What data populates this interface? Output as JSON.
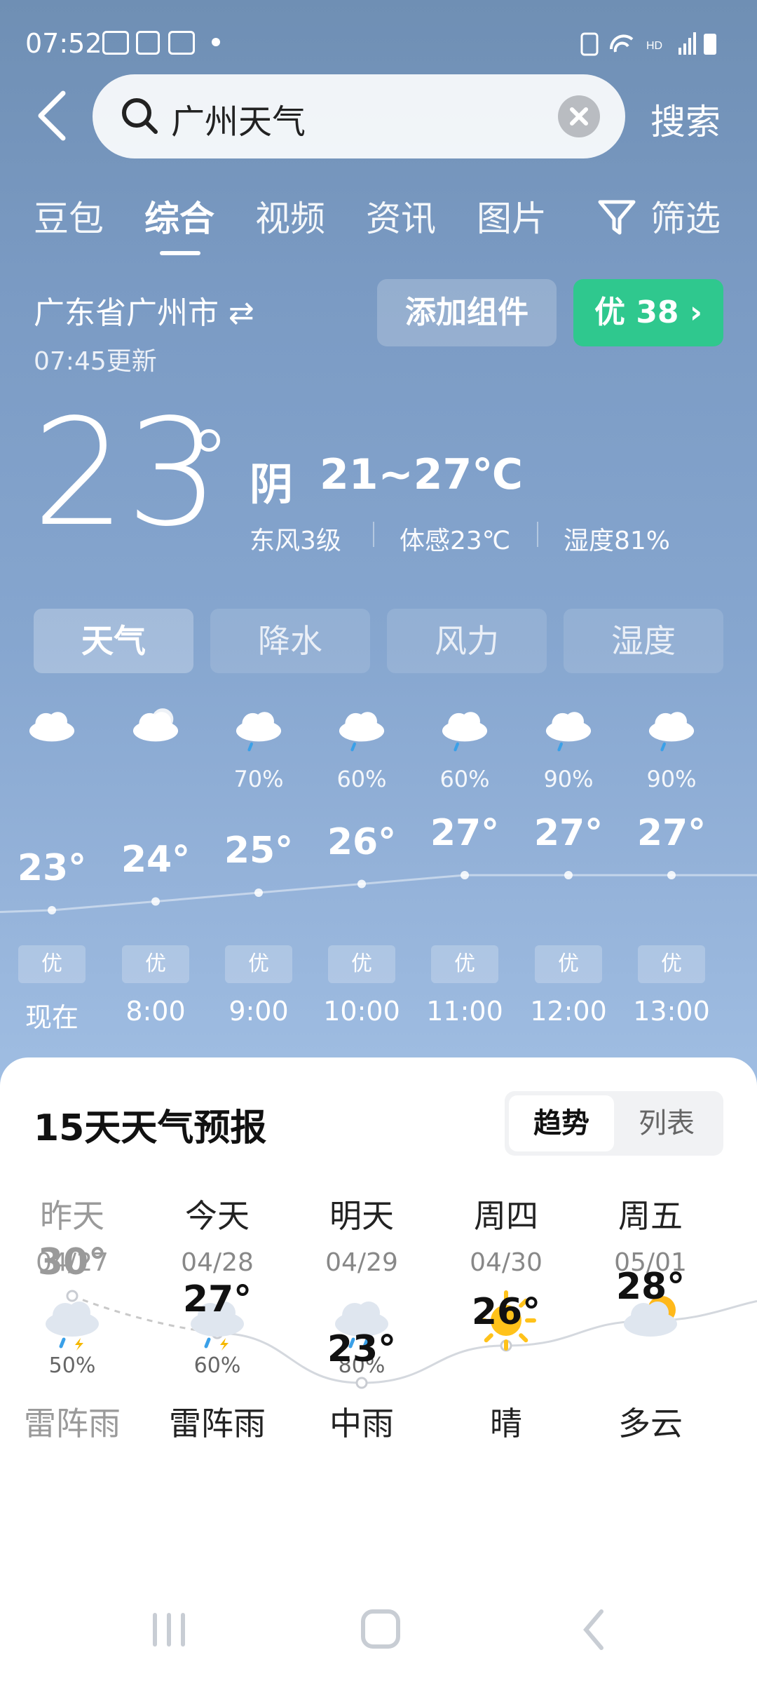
{
  "status_bar": {
    "time": "07:52"
  },
  "search": {
    "query": "广州天气",
    "button": "搜索"
  },
  "tabs": [
    {
      "label": "豆包"
    },
    {
      "label": "综合"
    },
    {
      "label": "视频"
    },
    {
      "label": "资讯"
    },
    {
      "label": "图片"
    },
    {
      "label": "筛选"
    }
  ],
  "active_tab": "综合",
  "location": {
    "name": "广东省广州市 ⇄",
    "updated": "07:45更新"
  },
  "actions": {
    "add_widget": "添加组件",
    "aqi": "优 38 ›"
  },
  "current": {
    "temp": "23",
    "condition": "阴",
    "range": "21~27℃",
    "wind": "东风3级",
    "feels": "体感23℃",
    "humidity": "湿度81%"
  },
  "metric_tabs": [
    {
      "label": "天气"
    },
    {
      "label": "降水"
    },
    {
      "label": "风力"
    },
    {
      "label": "湿度"
    }
  ],
  "hourly": [
    {
      "time": "现在",
      "temp": "23°",
      "pop": "",
      "aq": "优",
      "icon": "cloud-icon",
      "value": 23
    },
    {
      "time": "8:00",
      "temp": "24°",
      "pop": "",
      "aq": "优",
      "icon": "cloudy-icon",
      "value": 24
    },
    {
      "time": "9:00",
      "temp": "25°",
      "pop": "70%",
      "aq": "优",
      "icon": "rain-cloud-icon",
      "value": 25
    },
    {
      "time": "10:00",
      "temp": "26°",
      "pop": "60%",
      "aq": "优",
      "icon": "rain-cloud-icon",
      "value": 26
    },
    {
      "time": "11:00",
      "temp": "27°",
      "pop": "60%",
      "aq": "优",
      "icon": "rain-cloud-icon",
      "value": 27
    },
    {
      "time": "12:00",
      "temp": "27°",
      "pop": "90%",
      "aq": "优",
      "icon": "rain-cloud-icon",
      "value": 27
    },
    {
      "time": "13:00",
      "temp": "27°",
      "pop": "90%",
      "aq": "优",
      "icon": "rain-cloud-icon",
      "value": 27
    }
  ],
  "forecast": {
    "title": "15天天气预报",
    "toggle": [
      "趋势",
      "列表"
    ],
    "days": [
      {
        "name": "昨天",
        "date": "04/27",
        "pop": "50%",
        "cond": "雷阵雨",
        "temp": "30°",
        "value": 30,
        "icon": "thunder-rain-icon",
        "past": true
      },
      {
        "name": "今天",
        "date": "04/28",
        "pop": "60%",
        "cond": "雷阵雨",
        "temp": "27°",
        "value": 27,
        "icon": "thunder-rain-icon",
        "past": false
      },
      {
        "name": "明天",
        "date": "04/29",
        "pop": "80%",
        "cond": "中雨",
        "temp": "23°",
        "value": 23,
        "icon": "rain-icon",
        "past": false
      },
      {
        "name": "周四",
        "date": "04/30",
        "pop": "",
        "cond": "晴",
        "temp": "26°",
        "value": 26,
        "icon": "sun-icon",
        "past": false
      },
      {
        "name": "周五",
        "date": "05/01",
        "pop": "",
        "cond": "多云",
        "temp": "28°",
        "value": 28,
        "icon": "partly-cloudy-icon",
        "past": false
      }
    ]
  }
}
